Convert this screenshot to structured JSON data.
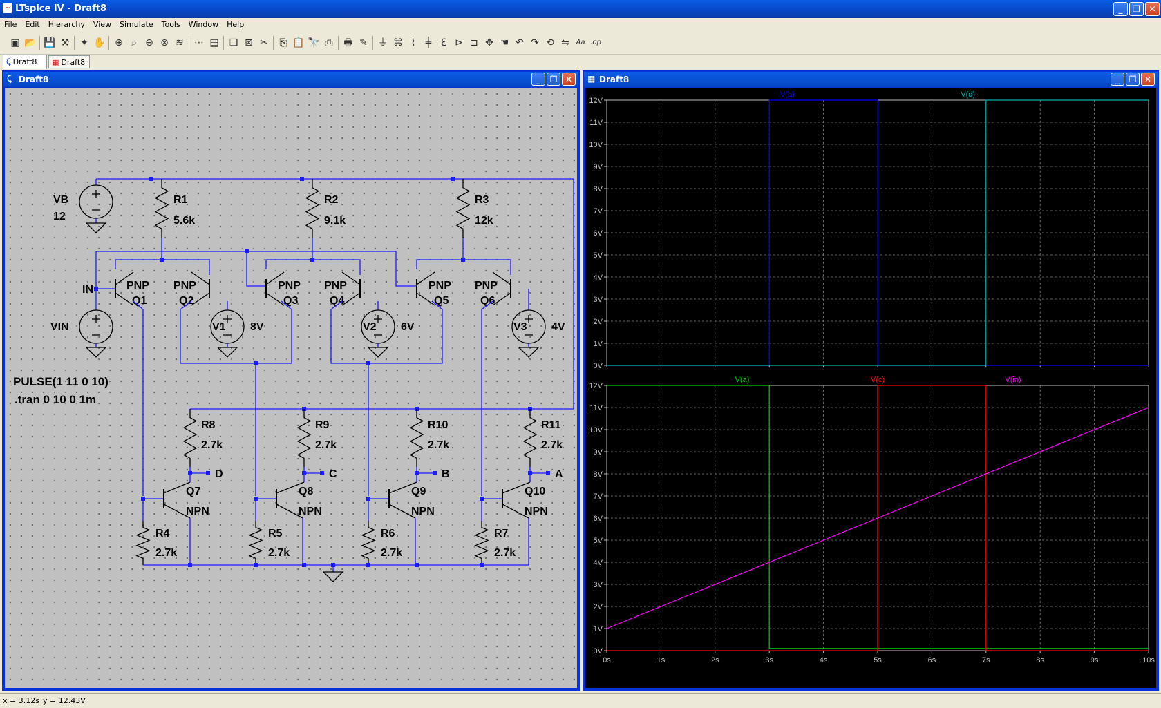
{
  "app": {
    "title": "LTspice IV - Draft8",
    "icon": "ltspice-logo-icon"
  },
  "menu": [
    "File",
    "Edit",
    "Hierarchy",
    "View",
    "Simulate",
    "Tools",
    "Window",
    "Help"
  ],
  "toolbar": [
    "new-schematic-icon",
    "open-icon",
    "save-icon",
    "control-panel-icon",
    "run-icon",
    "halt-icon",
    "zoom-in-icon",
    "zoom-pan-icon",
    "zoom-out-icon",
    "zoom-fit-icon",
    "autoscale-icon",
    "view-icon",
    "tile-horizontal-icon",
    "cascade-icon",
    "close-window-icon",
    "cut-icon",
    "copy-icon",
    "paste-icon",
    "find-icon",
    "print-setup-icon",
    "print-icon",
    "wire-icon",
    "ground-icon",
    "label-icon",
    "resistor-icon",
    "capacitor-icon",
    "inductor-icon",
    "diode-icon",
    "component-icon",
    "move-icon",
    "drag-icon",
    "undo-icon",
    "redo-icon",
    "rotate-icon",
    "mirror-icon",
    "text-icon",
    "spice-directive-icon"
  ],
  "tabs": [
    {
      "label": "Draft8",
      "icon": "schematic-icon"
    },
    {
      "label": "Draft8",
      "icon": "waveform-icon"
    }
  ],
  "schematic_window": {
    "title": "Draft8"
  },
  "waveform_window": {
    "title": "Draft8"
  },
  "schematic": {
    "sources": [
      {
        "name": "VB",
        "value": "12"
      },
      {
        "name": "VIN",
        "value": ""
      },
      {
        "name": "V1",
        "value": "8V"
      },
      {
        "name": "V2",
        "value": "6V"
      },
      {
        "name": "V3",
        "value": "4V"
      }
    ],
    "resistors": [
      {
        "name": "R1",
        "value": "5.6k"
      },
      {
        "name": "R2",
        "value": "9.1k"
      },
      {
        "name": "R3",
        "value": "12k"
      },
      {
        "name": "R4",
        "value": "2.7k"
      },
      {
        "name": "R5",
        "value": "2.7k"
      },
      {
        "name": "R6",
        "value": "2.7k"
      },
      {
        "name": "R7",
        "value": "2.7k"
      },
      {
        "name": "R8",
        "value": "2.7k"
      },
      {
        "name": "R9",
        "value": "2.7k"
      },
      {
        "name": "R10",
        "value": "2.7k"
      },
      {
        "name": "R11",
        "value": "2.7k"
      }
    ],
    "pnp": [
      {
        "type": "PNP",
        "name": "Q1"
      },
      {
        "type": "PNP",
        "name": "Q2"
      },
      {
        "type": "PNP",
        "name": "Q3"
      },
      {
        "type": "PNP",
        "name": "Q4"
      },
      {
        "type": "PNP",
        "name": "Q5"
      },
      {
        "type": "PNP",
        "name": "Q6"
      }
    ],
    "npn": [
      {
        "name": "Q7",
        "type": "NPN",
        "out": "D"
      },
      {
        "name": "Q8",
        "type": "NPN",
        "out": "C"
      },
      {
        "name": "Q9",
        "type": "NPN",
        "out": "B"
      },
      {
        "name": "Q10",
        "type": "NPN",
        "out": "A"
      }
    ],
    "in_label": "IN",
    "directives": [
      "PULSE(1 11 0 10)",
      ".tran 0 10 0 1m"
    ]
  },
  "chart_data": [
    {
      "type": "line",
      "xlim": [
        0,
        10
      ],
      "ylim": [
        0,
        12
      ],
      "yticks": [
        "0V",
        "1V",
        "2V",
        "3V",
        "4V",
        "5V",
        "6V",
        "7V",
        "8V",
        "9V",
        "10V",
        "11V",
        "12V"
      ],
      "grid": true,
      "series": [
        {
          "name": "V(b)",
          "color": "#0000ff",
          "x": [
            0,
            3,
            3,
            5,
            5,
            10
          ],
          "y": [
            0,
            0,
            12,
            12,
            0,
            0
          ]
        },
        {
          "name": "V(d)",
          "color": "#00b0b0",
          "x": [
            0,
            7,
            7,
            10
          ],
          "y": [
            0,
            0,
            12,
            12
          ]
        }
      ]
    },
    {
      "type": "line",
      "xlim": [
        0,
        10
      ],
      "ylim": [
        0,
        12
      ],
      "xticks": [
        "0s",
        "1s",
        "2s",
        "3s",
        "4s",
        "5s",
        "6s",
        "7s",
        "8s",
        "9s",
        "10s"
      ],
      "yticks": [
        "0V",
        "1V",
        "2V",
        "3V",
        "4V",
        "5V",
        "6V",
        "7V",
        "8V",
        "9V",
        "10V",
        "11V",
        "12V"
      ],
      "grid": true,
      "series": [
        {
          "name": "V(a)",
          "color": "#00d000",
          "x": [
            0,
            3,
            3,
            10
          ],
          "y": [
            12,
            12,
            0.1,
            0.1
          ]
        },
        {
          "name": "V(c)",
          "color": "#ff0000",
          "x": [
            0,
            5,
            5,
            7,
            7,
            10
          ],
          "y": [
            0,
            0,
            12,
            12,
            0,
            0
          ]
        },
        {
          "name": "V(in)",
          "color": "#ff00ff",
          "x": [
            0,
            10
          ],
          "y": [
            1,
            11
          ]
        }
      ]
    }
  ],
  "status": {
    "x": "x = 3.12s",
    "y": "y = 12.43V"
  }
}
